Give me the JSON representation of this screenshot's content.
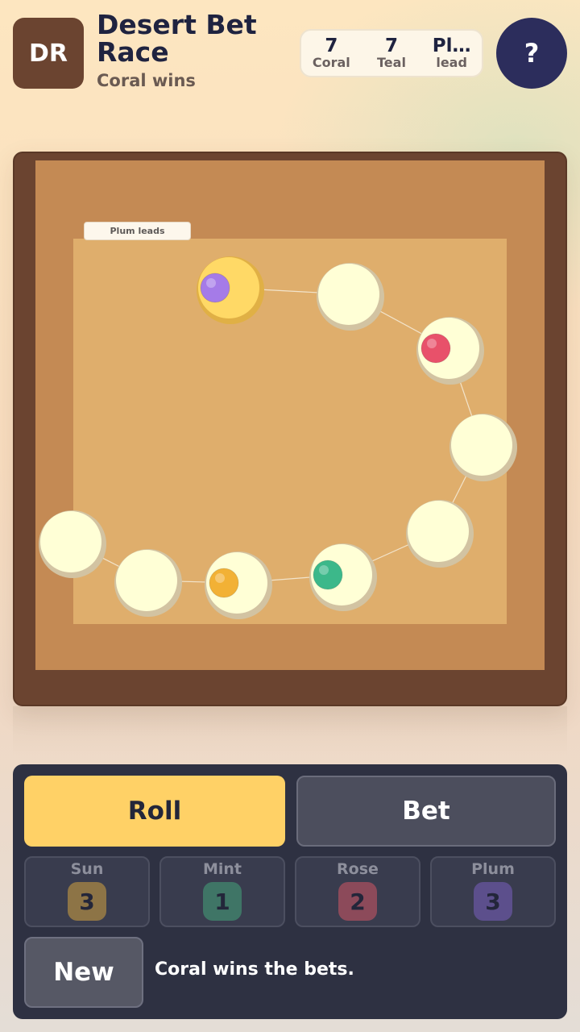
{
  "header": {
    "logo": "DR",
    "title": "Desert Bet Race",
    "subtitle": "Coral wins",
    "help_label": "?"
  },
  "stats": [
    {
      "value": "7",
      "label": "Coral"
    },
    {
      "value": "7",
      "label": "Teal"
    },
    {
      "value": "Pl…",
      "label": "lead"
    }
  ],
  "board": {
    "leader_tag": "Plum leads",
    "space_count": 10,
    "highlighted_space": 1,
    "colors": {
      "space": "#ffffd6",
      "highlight": "#ffd966",
      "frame": "#6b4430",
      "outer": "#c48a54",
      "inner": "#dfae6c"
    },
    "tokens": [
      {
        "name": "plum",
        "space": 1,
        "color": "#a57be8"
      },
      {
        "name": "rose",
        "space": 3,
        "color": "#e8516a"
      },
      {
        "name": "teal",
        "space": 6,
        "color": "#3cb88a"
      },
      {
        "name": "sun",
        "space": 7,
        "color": "#f2b135"
      }
    ]
  },
  "controls": {
    "roll_label": "Roll",
    "bet_label": "Bet",
    "new_label": "New",
    "status": "Coral wins the bets."
  },
  "bets": [
    {
      "name": "Sun",
      "value": "3",
      "color": "#8d7446"
    },
    {
      "name": "Mint",
      "value": "1",
      "color": "#3f7566"
    },
    {
      "name": "Rose",
      "value": "2",
      "color": "#8c4a5a"
    },
    {
      "name": "Plum",
      "value": "3",
      "color": "#5c4f8c"
    }
  ]
}
